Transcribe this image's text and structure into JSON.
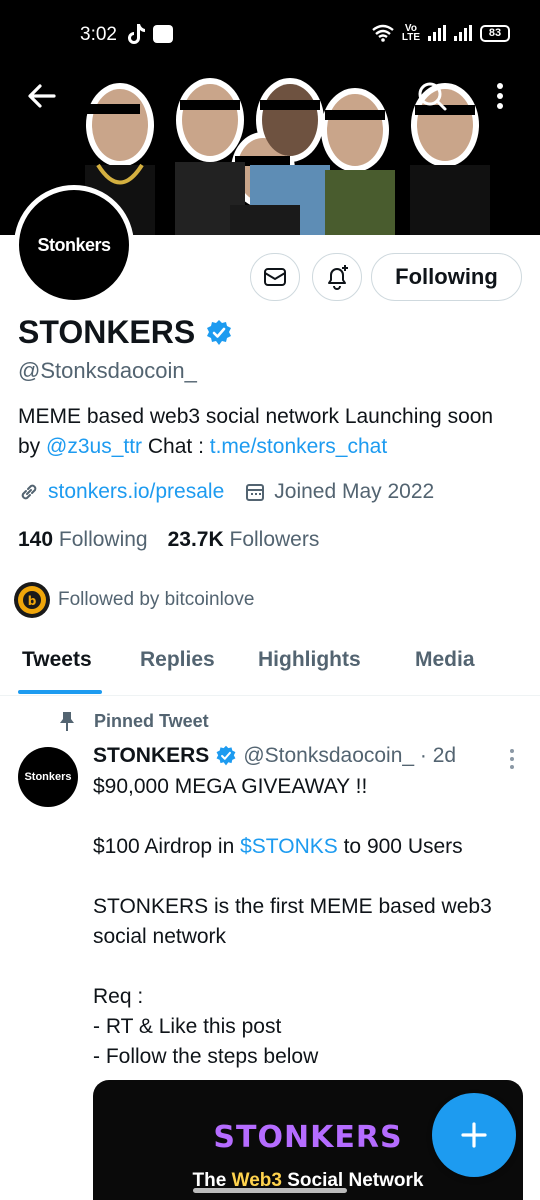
{
  "status_bar": {
    "time": "3:02",
    "volte": "Vo\nLTE",
    "battery": "83"
  },
  "profile": {
    "avatar_text": "Stonkers",
    "name": "STONKERS",
    "handle": "@Stonksdaocoin_",
    "following_label": "Following",
    "bio_text_1": "MEME based web3 social network Launching soon by ",
    "bio_mention": "@z3us_ttr",
    "bio_text_2": " Chat : ",
    "bio_link": "t.me/stonkers_chat",
    "website": "stonkers.io/presale",
    "joined": "Joined May 2022",
    "following_count": "140",
    "following_text": "Following",
    "followers_count": "23.7K",
    "followers_text": "Followers",
    "followed_by": "Followed by bitcoinlove"
  },
  "tabs": [
    {
      "label": "Tweets",
      "active": true
    },
    {
      "label": "Replies",
      "active": false
    },
    {
      "label": "Highlights",
      "active": false
    },
    {
      "label": "Media",
      "active": false
    }
  ],
  "tweet": {
    "pinned_label": "Pinned Tweet",
    "avatar_text": "Stonkers",
    "name": "STONKERS",
    "handle_time": "@Stonksdaocoin_ · 2d",
    "line1": "$90,000 MEGA GIVEAWAY !!",
    "line2_pre": "$100 Airdrop in ",
    "cashtag": "$STONKS",
    "line2_post": "  to 900 Users",
    "para2": "STONKERS is the first MEME based web3 social network",
    "req": "Req :\n- RT & Like this post\n- Follow the steps below",
    "media_title": "STONKERS",
    "media_sub_pre": "The ",
    "media_sub_hl": "Web3",
    "media_sub_post": " Social Network"
  },
  "colors": {
    "accent": "#1d9bf0",
    "text": "#0f1419",
    "secondary": "#536471"
  },
  "icons": [
    "back-arrow-icon",
    "search-icon",
    "more-vertical-icon",
    "mail-icon",
    "bell-plus-icon",
    "verified-badge-icon",
    "link-icon",
    "calendar-icon",
    "pin-icon",
    "compose-plus-icon"
  ]
}
